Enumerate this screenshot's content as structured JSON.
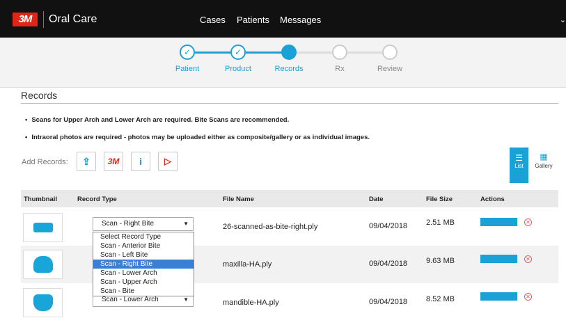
{
  "brand": {
    "logo_text": "3M",
    "name": "Oral Care"
  },
  "nav": {
    "items": [
      "Cases",
      "Patients",
      "Messages"
    ],
    "chevron": "⌄"
  },
  "steps": [
    {
      "label": "Patient",
      "state": "done",
      "symbol": "✓"
    },
    {
      "label": "Product",
      "state": "done",
      "symbol": "✓"
    },
    {
      "label": "Records",
      "state": "active",
      "symbol": ""
    },
    {
      "label": "Rx",
      "state": "todo",
      "symbol": ""
    },
    {
      "label": "Review",
      "state": "todo",
      "symbol": ""
    }
  ],
  "section": {
    "title": "Records",
    "notes": [
      "Scans for Upper Arch and Lower Arch are required. Bite Scans are recommended.",
      "Intraoral photos are required - photos may be uploaded either as composite/gallery or as individual images."
    ]
  },
  "add_records": {
    "label": "Add Records:",
    "buttons": [
      {
        "icon": "upload-icon",
        "glyph": "⇪"
      },
      {
        "icon": "3m-scanner-icon",
        "glyph": "3M"
      },
      {
        "icon": "itero-icon",
        "glyph": "i"
      },
      {
        "icon": "trios-icon",
        "glyph": "▷"
      }
    ]
  },
  "view_toggle": {
    "list": "List",
    "gallery": "Gallery"
  },
  "table": {
    "headers": [
      "Thumbnail",
      "Record Type",
      "File Name",
      "Date",
      "File Size",
      "Actions"
    ],
    "rows": [
      {
        "record_type": "Scan - Right Bite",
        "file_name": "26-scanned-as-bite-right.ply",
        "date": "09/04/2018",
        "file_size": "2.51 MB",
        "thumb": "bite-scan-icon"
      },
      {
        "record_type": "Scan - Upper Arch",
        "file_name": "maxilla-HA.ply",
        "date": "09/04/2018",
        "file_size": "9.63 MB",
        "thumb": "upper-arch-icon"
      },
      {
        "record_type": "Scan - Lower Arch",
        "file_name": "mandible-HA.ply",
        "date": "09/04/2018",
        "file_size": "8.52 MB",
        "thumb": "lower-arch-icon"
      }
    ]
  },
  "dropdown": {
    "options": [
      "Select Record Type",
      "Scan - Anterior Bite",
      "Scan - Left Bite",
      "Scan - Right Bite",
      "Scan - Lower Arch",
      "Scan - Upper Arch",
      "Scan - Bite"
    ],
    "selected_index": 3
  },
  "colors": {
    "accent": "#1aa1d6",
    "brand_red": "#e1251b",
    "topbar": "#111111"
  }
}
